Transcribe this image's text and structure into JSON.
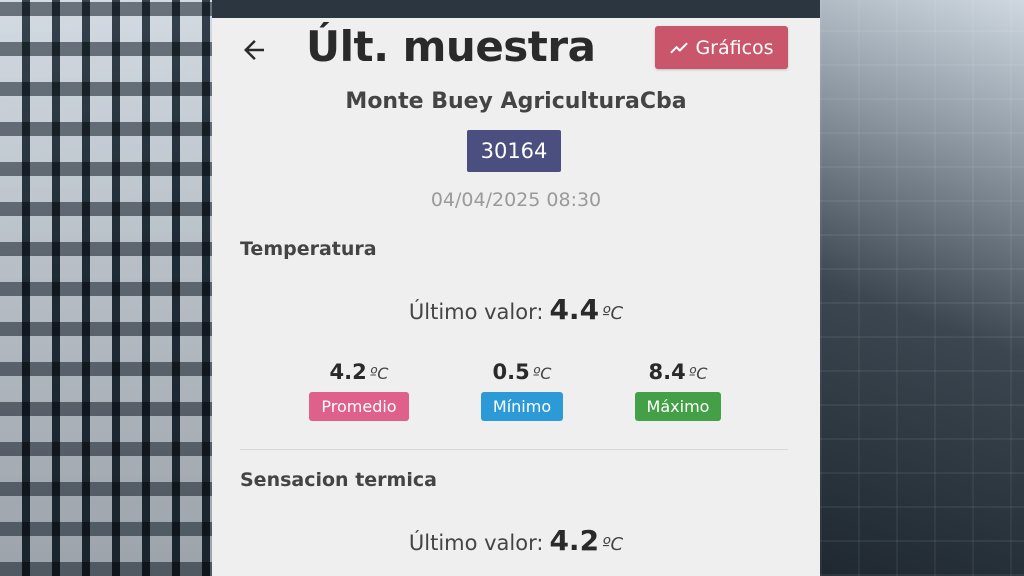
{
  "header": {
    "title": "Últ. muestra",
    "graficos_label": "Gráficos"
  },
  "station": {
    "name": "Monte Buey AgriculturaCba",
    "id": "30164",
    "timestamp": "04/04/2025 08:30"
  },
  "temperatura": {
    "title": "Temperatura",
    "last_label": "Último valor:",
    "last_value": "4.4",
    "unit": "ºC",
    "stats": [
      {
        "value": "4.2",
        "label": "Promedio",
        "color": "#e0608c"
      },
      {
        "value": "0.5",
        "label": "Mínimo",
        "color": "#2d9ad8"
      },
      {
        "value": "8.4",
        "label": "Máximo",
        "color": "#43a047"
      }
    ]
  },
  "sensacion": {
    "title": "Sensacion termica",
    "last_label": "Último valor:",
    "last_value": "4.2",
    "unit": "ºC"
  },
  "icons": {
    "back": "arrow-left-icon",
    "chart": "trending-up-icon"
  }
}
